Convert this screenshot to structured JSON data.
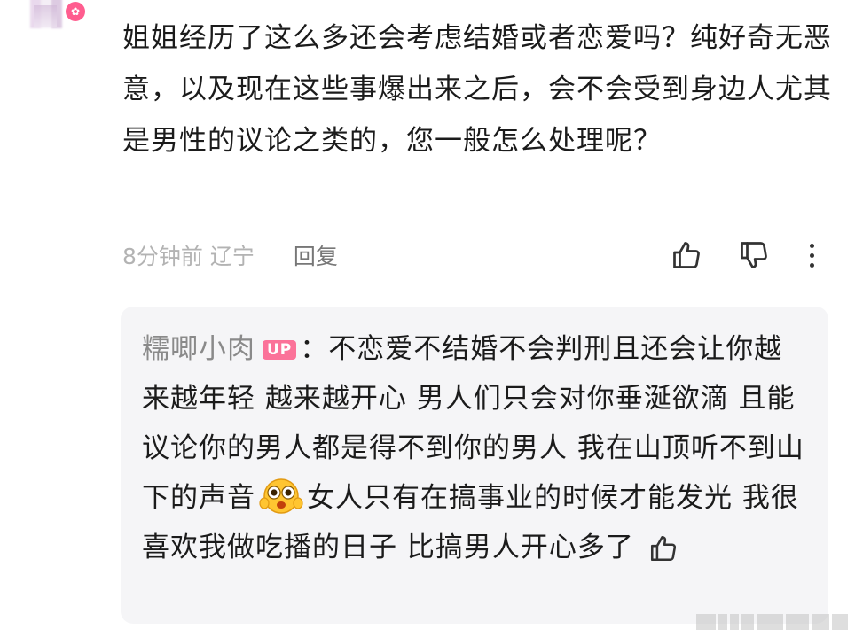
{
  "comment": {
    "text": "姐姐经历了这么多还会考虑结婚或者恋爱吗？纯好奇无恶意，以及现在这些事爆出来之后，会不会受到身边人尤其是男性的议论之类的，您一般怎么处理呢？",
    "time_location": "8分钟前 辽宁",
    "reply_label": "回复",
    "icons": {
      "avatar_badge": "chat-icon",
      "like": "thumb-up-icon",
      "dislike": "thumb-down-icon",
      "more": "more-vertical-icon"
    }
  },
  "reply": {
    "username": "糯唧小肉",
    "badge": "UP",
    "separator": "：",
    "text_before_emoji": "不恋爱不结婚不会判刑且还会让你越来越年轻 越来越开心 男人们只会对你垂涎欲滴 且能议论你的男人都是得不到你的男人 我在山顶听不到山下的声音",
    "emoji": "excited-face-emoji",
    "text_after_emoji": "女人只有在搞事业的时候才能发光 我很喜欢我做吃播的日子 比搞男人开心多了",
    "like_icon": "thumb-up-icon"
  },
  "colors": {
    "accent_pink": "#fb7299",
    "meta_gray": "#b3b3b3",
    "reply_bg": "#f5f5f7"
  }
}
